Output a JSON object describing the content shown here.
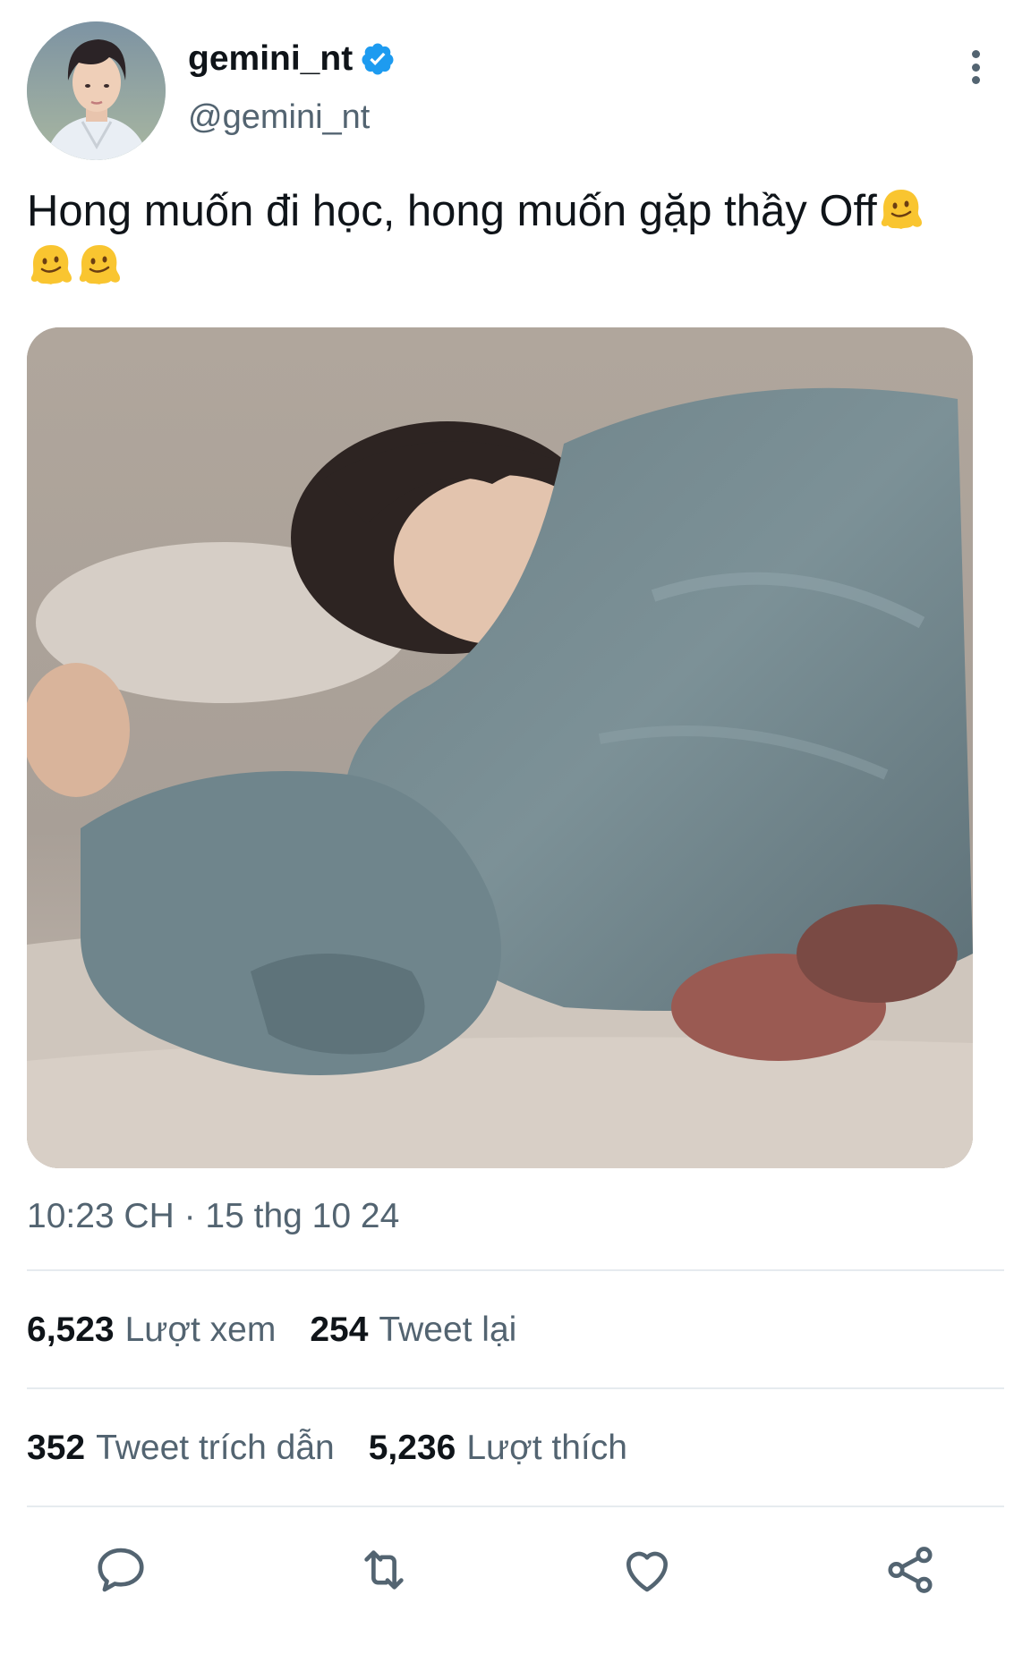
{
  "author": {
    "display_name": "gemini_nt",
    "handle": "@gemini_nt",
    "verified": true,
    "avatar_icon": "profile-photo"
  },
  "tweet": {
    "text": "Hong muốn đi học, hong muốn gặp thầy Off",
    "emojis": [
      "melting-face",
      "melting-face",
      "melting-face"
    ],
    "media_description_icon": "photo-person-under-blanket"
  },
  "meta": {
    "timestamp": "10:23 CH · 15 thg 10 24"
  },
  "stats": {
    "views_count": "6,523",
    "views_label": "Lượt xem",
    "retweets_count": "254",
    "retweets_label": "Tweet lại",
    "quotes_count": "352",
    "quotes_label": "Tweet trích dẫn",
    "likes_count": "5,236",
    "likes_label": "Lượt thích"
  },
  "actions": [
    "reply-icon",
    "retweet-icon",
    "like-icon",
    "share-icon"
  ],
  "colors": {
    "text_primary": "#0f1419",
    "text_secondary": "#536471",
    "verified": "#1d9bf0",
    "divider": "#e6ebef"
  }
}
